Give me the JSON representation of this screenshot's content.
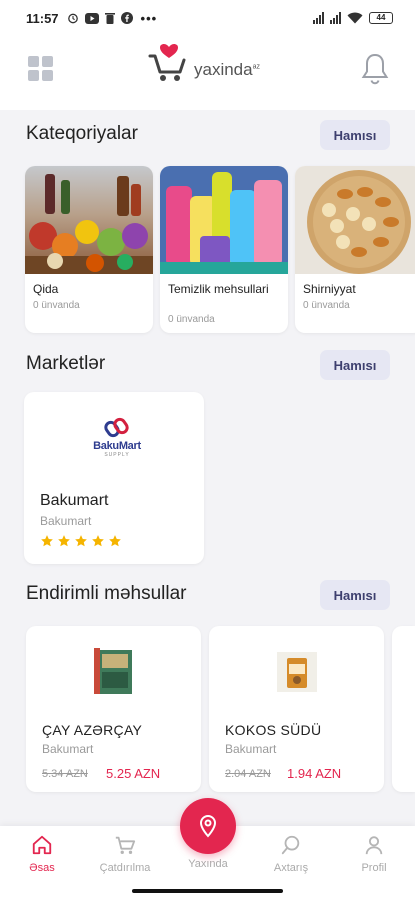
{
  "status_bar": {
    "time": "11:57",
    "icons": [
      "alarm-icon",
      "youtube-icon",
      "trash-icon",
      "facebook-icon",
      "more-dots-icon"
    ],
    "battery": "44"
  },
  "header": {
    "logo_text": "yaxinda",
    "logo_suffix": "az"
  },
  "categories": {
    "title": "Kateqoriyalar",
    "all_label": "Hamısı",
    "items": [
      {
        "name": "Qida",
        "sub": "0 ünvanda"
      },
      {
        "name": "Temizlik mehsullari",
        "sub": "0 ünvanda"
      },
      {
        "name": "Shirniyyat",
        "sub": "0 ünvanda"
      }
    ]
  },
  "markets": {
    "title": "Marketlər",
    "all_label": "Hamısı",
    "items": [
      {
        "logo_text": "BakuMart",
        "logo_sub": "SUPPLY",
        "name": "Bakumart",
        "sub": "Bakumart",
        "rating": 5
      }
    ]
  },
  "discounts": {
    "title": "Endirimli məhsullar",
    "all_label": "Hamısı",
    "items": [
      {
        "name": "ÇAY AZƏRÇAY",
        "store": "Bakumart",
        "old_price": "5.34 AZN",
        "new_price": "5.25 AZN"
      },
      {
        "name": "KOKOS SÜDÜ",
        "store": "Bakumart",
        "old_price": "2.04 AZN",
        "new_price": "1.94 AZN"
      }
    ]
  },
  "tabbar": {
    "items": [
      {
        "label": "Əsas",
        "icon": "home-icon",
        "active": true
      },
      {
        "label": "Çatdırılma",
        "icon": "cart-icon",
        "active": false
      },
      {
        "label": "Yaxında",
        "icon": "location-pin-icon",
        "active": false
      },
      {
        "label": "Axtarış",
        "icon": "search-icon",
        "active": false
      },
      {
        "label": "Profil",
        "icon": "user-icon",
        "active": false
      }
    ]
  },
  "colors": {
    "accent": "#e3264f",
    "button_bg": "#e6e7f3",
    "button_text": "#3d3f6e",
    "background": "#f3f3f6"
  }
}
